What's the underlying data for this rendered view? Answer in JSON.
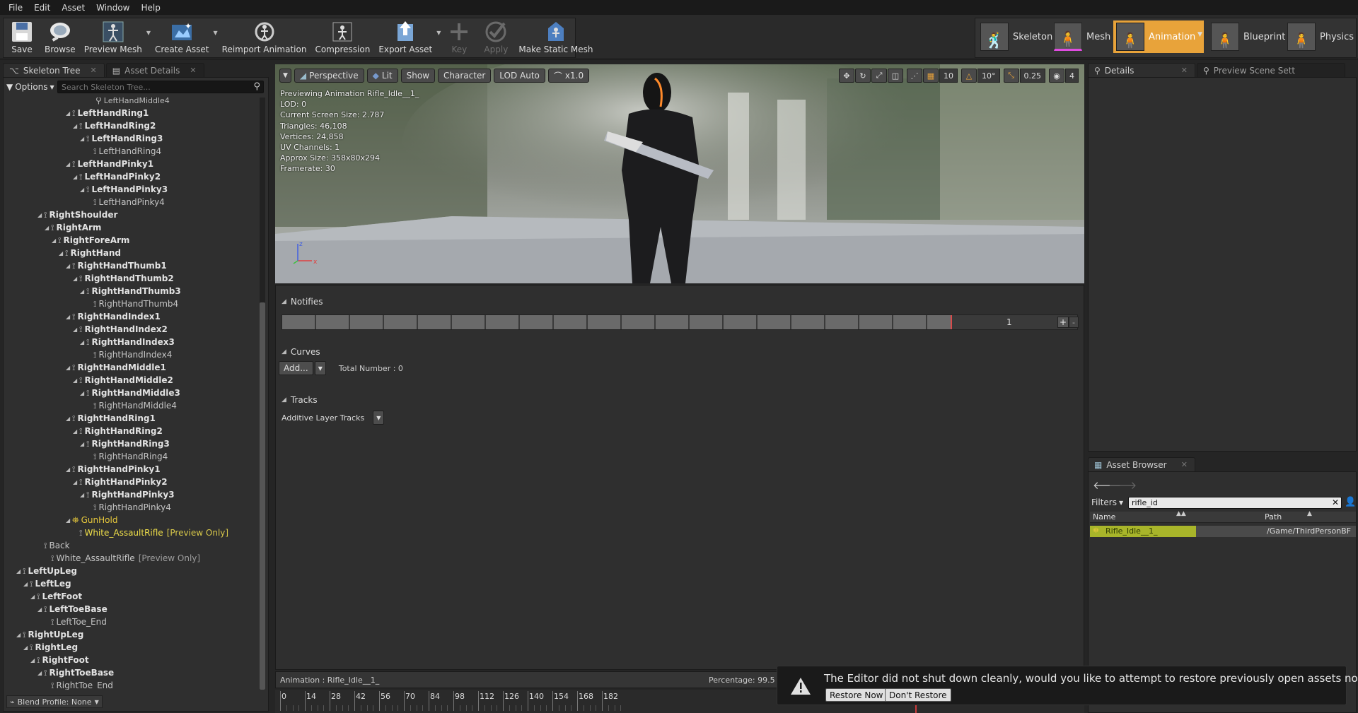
{
  "menu": [
    "File",
    "Edit",
    "Asset",
    "Window",
    "Help"
  ],
  "toolbar": {
    "save": "Save",
    "browse": "Browse",
    "preview_mesh": "Preview Mesh",
    "create_asset": "Create Asset",
    "reimport": "Reimport Animation",
    "compression": "Compression",
    "export": "Export Asset",
    "key": "Key",
    "apply": "Apply",
    "make_static_mesh": "Make Static Mesh"
  },
  "modes": {
    "skeleton": "Skeleton",
    "mesh": "Mesh",
    "animation": "Animation",
    "blueprint": "Blueprint",
    "physics": "Physics"
  },
  "left_tabs": {
    "skeleton_tree": "Skeleton Tree",
    "asset_details": "Asset Details"
  },
  "skeleton_tree": {
    "options": "Options",
    "search_placeholder": "Search Skeleton Tree...",
    "clipped_item": "LeftHandMiddle4",
    "rows": [
      {
        "label": "LeftHandRing1",
        "suffix": ""
      },
      {
        "label": "LeftHandRing2",
        "suffix": ""
      },
      {
        "label": "LeftHandRing3",
        "suffix": ""
      },
      {
        "label": "LeftHandRing4",
        "suffix": ""
      },
      {
        "label": "LeftHandPinky1",
        "suffix": ""
      },
      {
        "label": "LeftHandPinky2",
        "suffix": ""
      },
      {
        "label": "LeftHandPinky3",
        "suffix": ""
      },
      {
        "label": "LeftHandPinky4",
        "suffix": ""
      },
      {
        "label": "RightShoulder",
        "suffix": ""
      },
      {
        "label": "RightArm",
        "suffix": ""
      },
      {
        "label": "RightForeArm",
        "suffix": ""
      },
      {
        "label": "RightHand",
        "suffix": ""
      },
      {
        "label": "RightHandThumb1",
        "suffix": ""
      },
      {
        "label": "RightHandThumb2",
        "suffix": ""
      },
      {
        "label": "RightHandThumb3",
        "suffix": ""
      },
      {
        "label": "RightHandThumb4",
        "suffix": ""
      },
      {
        "label": "RightHandIndex1",
        "suffix": ""
      },
      {
        "label": "RightHandIndex2",
        "suffix": ""
      },
      {
        "label": "RightHandIndex3",
        "suffix": ""
      },
      {
        "label": "RightHandIndex4",
        "suffix": ""
      },
      {
        "label": "RightHandMiddle1",
        "suffix": ""
      },
      {
        "label": "RightHandMiddle2",
        "suffix": ""
      },
      {
        "label": "RightHandMiddle3",
        "suffix": ""
      },
      {
        "label": "RightHandMiddle4",
        "suffix": ""
      },
      {
        "label": "RightHandRing1",
        "suffix": ""
      },
      {
        "label": "RightHandRing2",
        "suffix": ""
      },
      {
        "label": "RightHandRing3",
        "suffix": ""
      },
      {
        "label": "RightHandRing4",
        "suffix": ""
      },
      {
        "label": "RightHandPinky1",
        "suffix": ""
      },
      {
        "label": "RightHandPinky2",
        "suffix": ""
      },
      {
        "label": "RightHandPinky3",
        "suffix": ""
      },
      {
        "label": "RightHandPinky4",
        "suffix": ""
      },
      {
        "label": "GunHold",
        "suffix": ""
      },
      {
        "label": "White_AssaultRifle",
        "suffix": "[Preview Only]"
      },
      {
        "label": "Back",
        "suffix": ""
      },
      {
        "label": "White_AssaultRifle",
        "suffix": "[Preview Only]"
      },
      {
        "label": "LeftUpLeg",
        "suffix": ""
      },
      {
        "label": "LeftLeg",
        "suffix": ""
      },
      {
        "label": "LeftFoot",
        "suffix": ""
      },
      {
        "label": "LeftToeBase",
        "suffix": ""
      },
      {
        "label": "LeftToe_End",
        "suffix": ""
      },
      {
        "label": "RightUpLeg",
        "suffix": ""
      },
      {
        "label": "RightLeg",
        "suffix": ""
      },
      {
        "label": "RightFoot",
        "suffix": ""
      },
      {
        "label": "RightToeBase",
        "suffix": ""
      },
      {
        "label": "RightToe_End",
        "suffix": ""
      }
    ],
    "blend_profile": "Blend Profile: None"
  },
  "viewport": {
    "perspective": "Perspective",
    "lit": "Lit",
    "show": "Show",
    "character": "Character",
    "lod": "LOD Auto",
    "speed": "x1.0",
    "grid_snap": "10",
    "rot_snap": "10°",
    "scale_snap": "0.25",
    "cam_speed": "4",
    "info": [
      "Previewing Animation Rifle_Idle__1_",
      "LOD: 0",
      "Current Screen Size: 2.787",
      "Triangles: 46,108",
      "Vertices: 24,858",
      "UV Channels: 1",
      "Approx Size: 358x80x294",
      "Framerate: 30"
    ]
  },
  "editor": {
    "notifies": "Notifies",
    "track_number": "1",
    "curves": "Curves",
    "add": "Add...",
    "total_number": "Total Number : 0",
    "tracks": "Tracks",
    "additive_tracks": "Additive Layer Tracks"
  },
  "timeline": {
    "animation_label": "Animation :  Rifle_Idle__1_",
    "percentage": "Percentage:  99.5",
    "ticks": [
      "0",
      "14",
      "28",
      "42",
      "56",
      "70",
      "84",
      "98",
      "112",
      "126",
      "140",
      "154",
      "168",
      "182"
    ]
  },
  "right_tabs": {
    "details": "Details",
    "preview_scene": "Preview Scene Sett"
  },
  "asset_browser": {
    "tab": "Asset Browser",
    "filters": "Filters",
    "search_value": "rifle_id",
    "col_name": "Name",
    "col_path": "Path",
    "row_name": "Rifle_Idle__1_",
    "row_path": "/Game/ThirdPersonBF"
  },
  "toast": {
    "message": "The Editor did not shut down cleanly, would you like to attempt to restore previously open assets now?",
    "restore": "Restore Now",
    "dont_restore": "Don't Restore"
  }
}
